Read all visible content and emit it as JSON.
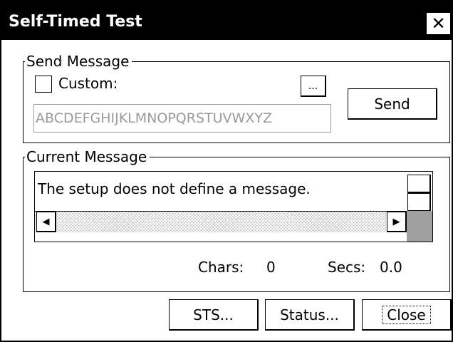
{
  "window": {
    "title": "Self-Timed Test",
    "close_symbol": "✕"
  },
  "send_message": {
    "group_label": "Send Message",
    "custom_label": "Custom:",
    "custom_checked": false,
    "browse_label": "...",
    "message_value": "ABCDEFGHIJKLMNOPQRSTUVWXYZ",
    "send_label": "Send"
  },
  "current_message": {
    "group_label": "Current Message",
    "text": "The setup does not define a message.",
    "chars_label": "Chars:",
    "chars_value": "0",
    "secs_label": "Secs:",
    "secs_value": "0.0",
    "scroll_left_icon": "◀",
    "scroll_right_icon": "▶"
  },
  "footer": {
    "sts_label": "STS...",
    "status_label": "Status...",
    "close_label": "Close"
  },
  "colors": {
    "titlebar": "#000000",
    "disabled_text": "#9a9a9a",
    "scroll_track": "#c8c8c8"
  }
}
